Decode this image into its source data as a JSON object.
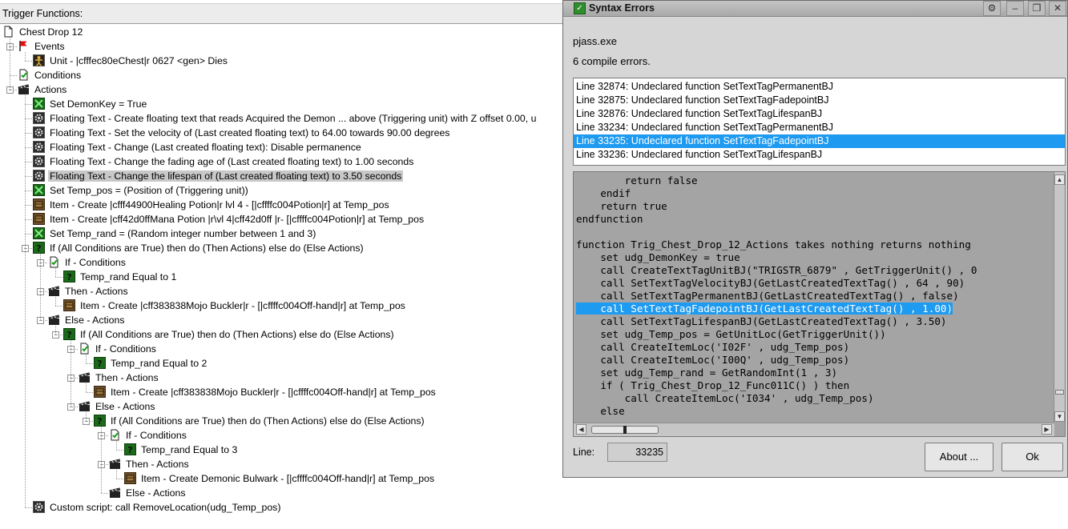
{
  "trigger_panel": {
    "header": "Trigger Functions:",
    "nodes": [
      {
        "level": 0,
        "icon": "document",
        "label": "Chest Drop 12",
        "expander": "none"
      },
      {
        "level": 1,
        "icon": "flag",
        "label": "Events",
        "expander": "-"
      },
      {
        "level": 2,
        "icon": "unit",
        "label": "Unit - |cfffec80eChest|r 0627 <gen> Dies",
        "expander": "none"
      },
      {
        "level": 1,
        "icon": "condition",
        "label": "Conditions",
        "expander": "none"
      },
      {
        "level": 1,
        "icon": "clapper",
        "label": "Actions",
        "expander": "-"
      },
      {
        "level": 2,
        "icon": "variable",
        "label": "Set DemonKey = True",
        "expander": "none"
      },
      {
        "level": 2,
        "icon": "gear",
        "label": "Floating Text - Create floating text that reads Acquired the Demon ... above (Triggering unit) with Z offset 0.00, u",
        "expander": "none"
      },
      {
        "level": 2,
        "icon": "gear",
        "label": "Floating Text - Set the velocity of (Last created floating text) to 64.00 towards 90.00 degrees",
        "expander": "none"
      },
      {
        "level": 2,
        "icon": "gear",
        "label": "Floating Text - Change (Last created floating text): Disable permanence",
        "expander": "none"
      },
      {
        "level": 2,
        "icon": "gear",
        "label": "Floating Text - Change the fading age of (Last created floating text) to 1.00 seconds",
        "expander": "none"
      },
      {
        "level": 2,
        "icon": "gear",
        "label": "Floating Text - Change the lifespan of (Last created floating text) to 3.50 seconds",
        "expander": "none",
        "selected": true
      },
      {
        "level": 2,
        "icon": "variable",
        "label": "Set Temp_pos = (Position of (Triggering unit))",
        "expander": "none"
      },
      {
        "level": 2,
        "icon": "item",
        "label": "Item - Create |cfff44900Healing Potion|r lvl 4 - [|cffffc004Potion|r] at Temp_pos",
        "expander": "none"
      },
      {
        "level": 2,
        "icon": "item",
        "label": "Item - Create |cff42d0ffMana Potion |r\\vl 4|cff42d0ff |r- [|cffffc004Potion|r] at Temp_pos",
        "expander": "none"
      },
      {
        "level": 2,
        "icon": "variable",
        "label": "Set Temp_rand = (Random integer number between 1 and 3)",
        "expander": "none"
      },
      {
        "level": 2,
        "icon": "question",
        "label": "If (All Conditions are True) then do (Then Actions) else do (Else Actions)",
        "expander": "-"
      },
      {
        "level": 3,
        "icon": "condition",
        "label": "If - Conditions",
        "expander": "-"
      },
      {
        "level": 4,
        "icon": "question",
        "label": "Temp_rand Equal to 1",
        "expander": "none"
      },
      {
        "level": 3,
        "icon": "clapper",
        "label": "Then - Actions",
        "expander": "-"
      },
      {
        "level": 4,
        "icon": "item",
        "label": "Item - Create |cff383838Mojo Buckler|r - [|cffffc004Off-hand|r] at Temp_pos",
        "expander": "none"
      },
      {
        "level": 3,
        "icon": "clapper",
        "label": "Else - Actions",
        "expander": "-"
      },
      {
        "level": 4,
        "icon": "question",
        "label": "If (All Conditions are True) then do (Then Actions) else do (Else Actions)",
        "expander": "-"
      },
      {
        "level": 5,
        "icon": "condition",
        "label": "If - Conditions",
        "expander": "-"
      },
      {
        "level": 6,
        "icon": "question",
        "label": "Temp_rand Equal to 2",
        "expander": "none"
      },
      {
        "level": 5,
        "icon": "clapper",
        "label": "Then - Actions",
        "expander": "-"
      },
      {
        "level": 6,
        "icon": "item",
        "label": "Item - Create |cff383838Mojo Buckler|r - [|cffffc004Off-hand|r] at Temp_pos",
        "expander": "none"
      },
      {
        "level": 5,
        "icon": "clapper",
        "label": "Else - Actions",
        "expander": "-"
      },
      {
        "level": 6,
        "icon": "question",
        "label": "If (All Conditions are True) then do (Then Actions) else do (Else Actions)",
        "expander": "-"
      },
      {
        "level": 7,
        "icon": "condition",
        "label": "If - Conditions",
        "expander": "-"
      },
      {
        "level": 8,
        "icon": "question",
        "label": "Temp_rand Equal to 3",
        "expander": "none"
      },
      {
        "level": 7,
        "icon": "clapper",
        "label": "Then - Actions",
        "expander": "-"
      },
      {
        "level": 8,
        "icon": "item",
        "label": "Item - Create Demonic Bulwark - [|cffffc004Off-hand|r] at Temp_pos",
        "expander": "none"
      },
      {
        "level": 7,
        "icon": "clapper",
        "label": "Else - Actions",
        "expander": "none"
      },
      {
        "level": 2,
        "icon": "gear",
        "label": "Custom script:   call RemoveLocation(udg_Temp_pos)",
        "expander": "none"
      }
    ]
  },
  "dialog": {
    "title": "Syntax Errors",
    "exe": "pjass.exe",
    "error_count": "6 compile errors.",
    "errors": [
      {
        "text": "Line 32874:  Undeclared function SetTextTagPermanentBJ"
      },
      {
        "text": "Line 32875:  Undeclared function SetTextTagFadepointBJ"
      },
      {
        "text": "Line 32876:  Undeclared function SetTextTagLifespanBJ"
      },
      {
        "text": "Line 33234:  Undeclared function SetTextTagPermanentBJ"
      },
      {
        "text": "Line 33235:  Undeclared function SetTextTagFadepointBJ",
        "selected": true
      },
      {
        "text": "Line 33236:  Undeclared function SetTextTagLifespanBJ"
      }
    ],
    "code": [
      "        return false",
      "    endif",
      "    return true",
      "endfunction",
      "",
      "function Trig_Chest_Drop_12_Actions takes nothing returns nothing",
      "    set udg_DemonKey = true",
      "    call CreateTextTagUnitBJ(\"TRIGSTR_6879\" , GetTriggerUnit() , 0",
      "    call SetTextTagVelocityBJ(GetLastCreatedTextTag() , 64 , 90)",
      "    call SetTextTagPermanentBJ(GetLastCreatedTextTag() , false)",
      "    call SetTextTagFadepointBJ(GetLastCreatedTextTag() , 1.00)",
      "    call SetTextTagLifespanBJ(GetLastCreatedTextTag() , 3.50)",
      "    set udg_Temp_pos = GetUnitLoc(GetTriggerUnit())",
      "    call CreateItemLoc('I02F' , udg_Temp_pos)",
      "    call CreateItemLoc('I00Q' , udg_Temp_pos)",
      "    set udg_Temp_rand = GetRandomInt(1 , 3)",
      "    if ( Trig_Chest_Drop_12_Func011C() ) then",
      "        call CreateItemLoc('I034' , udg_Temp_pos)",
      "    else"
    ],
    "highlight_line_index": 10,
    "line_label": "Line:",
    "line_value": "33235",
    "about_button": "About ...",
    "ok_button": "Ok"
  },
  "colors": {
    "selection": "#1e9af0",
    "code_background": "#a4a4a4",
    "dialog_background": "#d6d6d6"
  }
}
